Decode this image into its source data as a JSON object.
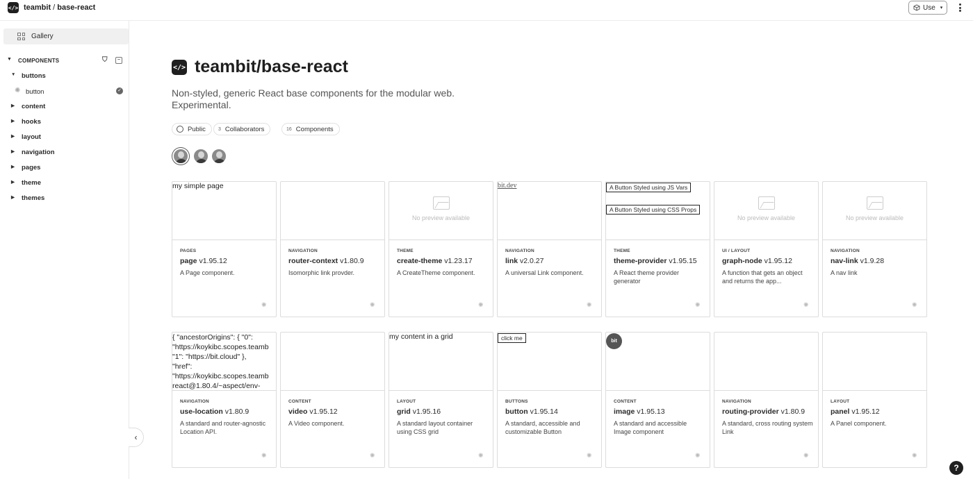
{
  "header": {
    "logo_glyph": "</>",
    "scope_org": "teambit",
    "scope_sep": " / ",
    "scope_name": "base-react",
    "use_label": "Use",
    "use_caret": "▾"
  },
  "sidebar": {
    "gallery_label": "Gallery",
    "section_label": "COMPONENTS",
    "items": [
      {
        "label": "buttons",
        "expanded": true
      },
      {
        "label": "content",
        "expanded": false
      },
      {
        "label": "hooks",
        "expanded": false
      },
      {
        "label": "layout",
        "expanded": false
      },
      {
        "label": "navigation",
        "expanded": false
      },
      {
        "label": "pages",
        "expanded": false
      },
      {
        "label": "theme",
        "expanded": false
      },
      {
        "label": "themes",
        "expanded": false
      }
    ],
    "leaf": {
      "label": "button"
    },
    "collapse_glyph": "‹"
  },
  "hero": {
    "logo_glyph": "</>",
    "title": "teambit/base-react",
    "description": "Non-styled, generic React base components for the modular web. Experimental.",
    "pills": {
      "visibility": "Public",
      "collaborators_count": "3",
      "collaborators_label": "Collaborators",
      "components_count": "16",
      "components_label": "Components"
    }
  },
  "cards": [
    {
      "preview_text": "my simple page",
      "namespace": "PAGES",
      "name": "page",
      "version": "v1.95.12",
      "description": "A Page component."
    },
    {
      "namespace": "NAVIGATION",
      "name": "router-context",
      "version": "v1.80.9",
      "description": "Isomorphic link provder."
    },
    {
      "no_preview": "No preview available",
      "namespace": "THEME",
      "name": "create-theme",
      "version": "v1.23.17",
      "description": "A CreateTheme component."
    },
    {
      "preview_link": "bit.dev",
      "namespace": "NAVIGATION",
      "name": "link",
      "version": "v2.0.27",
      "description": "A universal Link component."
    },
    {
      "preview_btn1": "A Button Styled using JS Vars",
      "preview_btn2": "A Button Styled using CSS Props",
      "namespace": "THEME",
      "name": "theme-provider",
      "version": "v1.95.15",
      "description": "A React theme provider generator"
    },
    {
      "no_preview": "No preview available",
      "namespace": "UI / LAYOUT",
      "name": "graph-node",
      "version": "v1.95.12",
      "description": "A function that gets an object and returns the app..."
    },
    {
      "no_preview": "No preview available",
      "namespace": "NAVIGATION",
      "name": "nav-link",
      "version": "v1.9.28",
      "description": "A nav link"
    },
    {
      "preview_code": "{ \"ancestorOrigins\": { \"0\":\n\"https://koykibc.scopes.teamb\n\"1\": \"https://bit.cloud\" },\n\"href\":\n\"https://koykibc.scopes.teamb\nreact@1.80.4/~aspect/env-",
      "namespace": "NAVIGATION",
      "name": "use-location",
      "version": "v1.80.9",
      "description": "A standard and router-agnostic Location API."
    },
    {
      "namespace": "CONTENT",
      "name": "video",
      "version": "v1.95.12",
      "description": "A Video component."
    },
    {
      "preview_text": "my content in a grid",
      "namespace": "LAYOUT",
      "name": "grid",
      "version": "v1.95.16",
      "description": "A standard layout container using CSS grid"
    },
    {
      "preview_click": "click me",
      "namespace": "BUTTONS",
      "name": "button",
      "version": "v1.95.14",
      "description": "A standard, accessible and customizable Button"
    },
    {
      "preview_badge": "bit",
      "namespace": "CONTENT",
      "name": "image",
      "version": "v1.95.13",
      "description": "A standard and accessible Image component"
    },
    {
      "namespace": "NAVIGATION",
      "name": "routing-provider",
      "version": "v1.80.9",
      "description": "A standard, cross routing system Link"
    },
    {
      "namespace": "LAYOUT",
      "name": "panel",
      "version": "v1.95.12",
      "description": "A Panel component."
    }
  ],
  "help_glyph": "?",
  "icons": {
    "gear": "gear-icon",
    "sun": "component-icon",
    "check": "check-icon",
    "filter": "filter-icon"
  }
}
